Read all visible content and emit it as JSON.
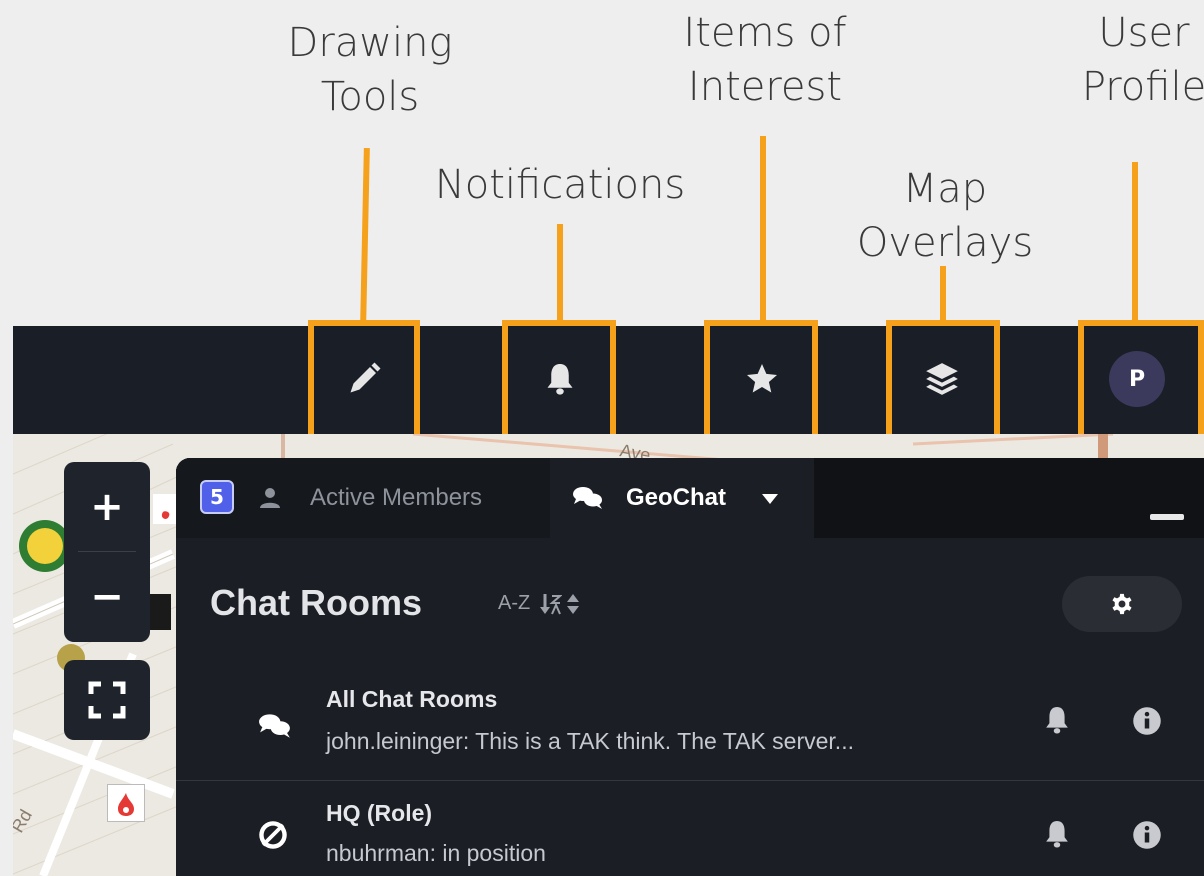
{
  "annotations": {
    "drawing_tools": "Drawing\nTools",
    "notifications": "Notifications",
    "items_of_interest": "Items of\nInterest",
    "map_overlays": "Map\nOverlays",
    "user_profile": "User\nProfile"
  },
  "toolbar": {
    "drawing_tools_icon": "pencil-icon",
    "notifications_icon": "bell-icon",
    "items_of_interest_icon": "star-icon",
    "map_overlays_icon": "layers-icon",
    "user_avatar_letter": "P"
  },
  "map_controls": {
    "zoom_in": "+",
    "zoom_out": "−",
    "fullscreen_icon": "fullscreen-icon"
  },
  "map_labels": {
    "street_ave": "Ave",
    "street_rd": "Rd"
  },
  "panel": {
    "active_members_count": "5",
    "tab_active_members": "Active Members",
    "tab_geochat": "GeoChat",
    "title": "Chat Rooms",
    "sort_label": "A-Z",
    "rooms": [
      {
        "title": "All Chat Rooms",
        "last_message": "john.leininger: This is a TAK think. The TAK server...",
        "icon": "comments-icon"
      },
      {
        "title": "HQ (Role)",
        "last_message": "nbuhrman: in position",
        "icon": "role-slash-icon"
      }
    ]
  },
  "colors": {
    "annotation_orange": "#f5a11c",
    "topbar_bg": "#1a1e27",
    "panel_bg": "#1b1e24",
    "badge_blue": "#5160e8",
    "avatar_purple": "#3b3a5c"
  }
}
